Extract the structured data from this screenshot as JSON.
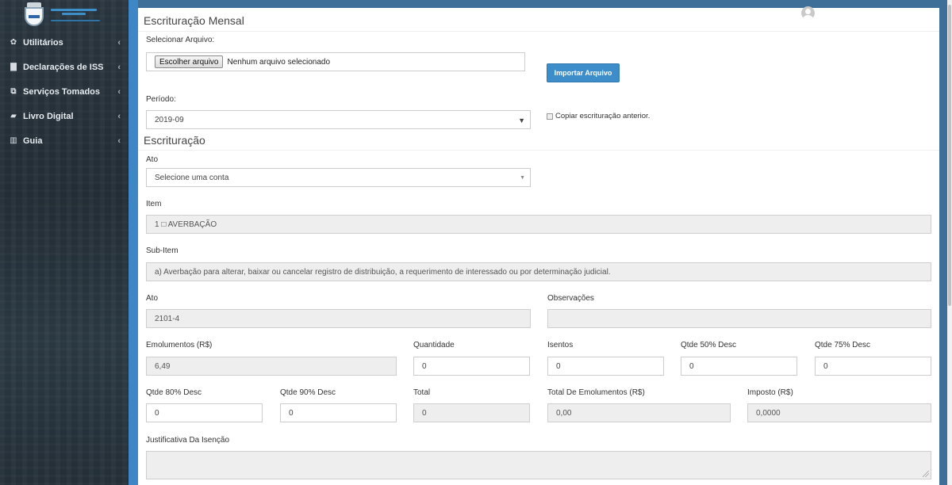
{
  "sidebar": {
    "items": [
      {
        "label": "Utilitários",
        "icon": "gear-icon",
        "glyph": "✿"
      },
      {
        "label": "Declarações de ISS",
        "icon": "file-icon",
        "glyph": "▇"
      },
      {
        "label": "Serviços Tomados",
        "icon": "copy-icon",
        "glyph": "⧉"
      },
      {
        "label": "Livro Digital",
        "icon": "book-icon",
        "glyph": "▰"
      },
      {
        "label": "Guia",
        "icon": "barcode-icon",
        "glyph": "▥"
      }
    ],
    "caret": "‹"
  },
  "panel": {
    "title": "Escrituração Mensal",
    "file_label": "Selecionar Arquivo:",
    "file_button": "Escolher arquivo",
    "file_status": "Nenhum arquivo selecionado",
    "import_button": "Importar Arquivo",
    "periodo_label": "Período:",
    "periodo_value": "2019-09",
    "copy_checkbox_label": "Copiar escrituração anterior."
  },
  "escrituracao": {
    "title": "Escrituração",
    "ato_label": "Ato",
    "ato_select": "Selecione uma conta",
    "item_label": "Item",
    "item_value": "1 □ AVERBAÇÃO",
    "subitem_label": "Sub-Item",
    "subitem_value": "a) Averbação para alterar, baixar ou cancelar registro de distribuição, a requerimento de interessado ou por determinação judicial.",
    "ato2_label": "Ato",
    "ato2_value": "2101-4",
    "obs_label": "Observações",
    "obs_value": "",
    "emolumentos_label": "Emolumentos (R$)",
    "emolumentos_value": "6,49",
    "quantidade_label": "Quantidade",
    "quantidade_value": "0",
    "isentos_label": "Isentos",
    "isentos_value": "0",
    "qtde50_label": "Qtde 50% Desc",
    "qtde50_value": "0",
    "qtde75_label": "Qtde 75% Desc",
    "qtde75_value": "0",
    "qtde80_label": "Qtde 80% Desc",
    "qtde80_value": "0",
    "qtde90_label": "Qtde 90% Desc",
    "qtde90_value": "0",
    "total_label": "Total",
    "total_value": "0",
    "total_emol_label": "Total De Emolumentos (R$)",
    "total_emol_value": "0,00",
    "imposto_label": "Imposto (R$)",
    "imposto_value": "0,0000",
    "justificativa_label": "Justificativa Da Isenção"
  }
}
